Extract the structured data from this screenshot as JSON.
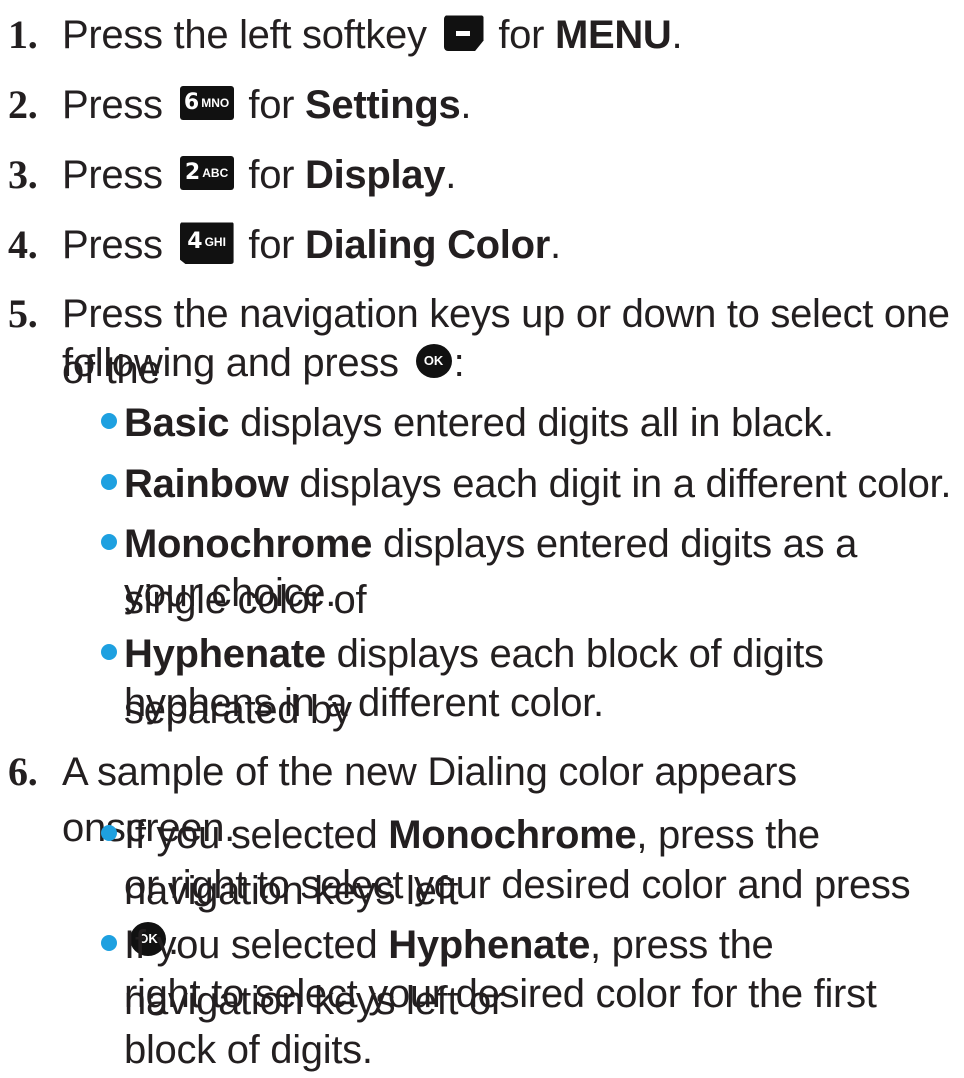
{
  "steps": [
    {
      "number": "1.",
      "pre": "Press the left softkey",
      "mid": "for",
      "bold": "MENU",
      "end": "."
    },
    {
      "number": "2.",
      "pre": "Press",
      "key": {
        "digit": "6",
        "letters": "MNO"
      },
      "mid": "for",
      "bold": "Settings",
      "end": "."
    },
    {
      "number": "3.",
      "pre": "Press",
      "key": {
        "digit": "2",
        "letters": "ABC"
      },
      "mid": "for",
      "bold": "Display",
      "end": "."
    },
    {
      "number": "4.",
      "pre": "Press",
      "key": {
        "digit": "4",
        "letters": "GHI"
      },
      "mid": "for",
      "bold": "Dialing Color",
      "end": "."
    },
    {
      "number": "5.",
      "line1": "Press the navigation keys up or down to select one of the",
      "line2_pre": "following and press",
      "line2_end": ":"
    },
    {
      "number": "6.",
      "text": "A sample of the new Dialing color appears onscreen."
    }
  ],
  "ok_label": "OK",
  "step5_bullets": [
    {
      "bold": "Basic",
      "text": " displays entered digits all in black."
    },
    {
      "bold": "Rainbow",
      "text": " displays each digit in a different color."
    },
    {
      "bold": "Monochrome",
      "text": " displays entered digits as a single color of",
      "line2": "your choice."
    },
    {
      "bold": "Hyphenate",
      "text": " displays each block of digits separated by",
      "line2": "hyphens in a different color."
    }
  ],
  "step6_bullets": [
    {
      "pre": "If you selected ",
      "bold": "Monochrome",
      "text": ", press the navigation keys left",
      "line2": "or right to select your desired color and press",
      "line2_end": "."
    },
    {
      "pre": "If you selected ",
      "bold": "Hyphenate",
      "text": ", press the navigation keys left or",
      "line2": "right to select your desired color for the first block of digits."
    }
  ],
  "colors": {
    "bullet": "#1ea0e0",
    "key": "#111111",
    "text": "#231f20"
  }
}
